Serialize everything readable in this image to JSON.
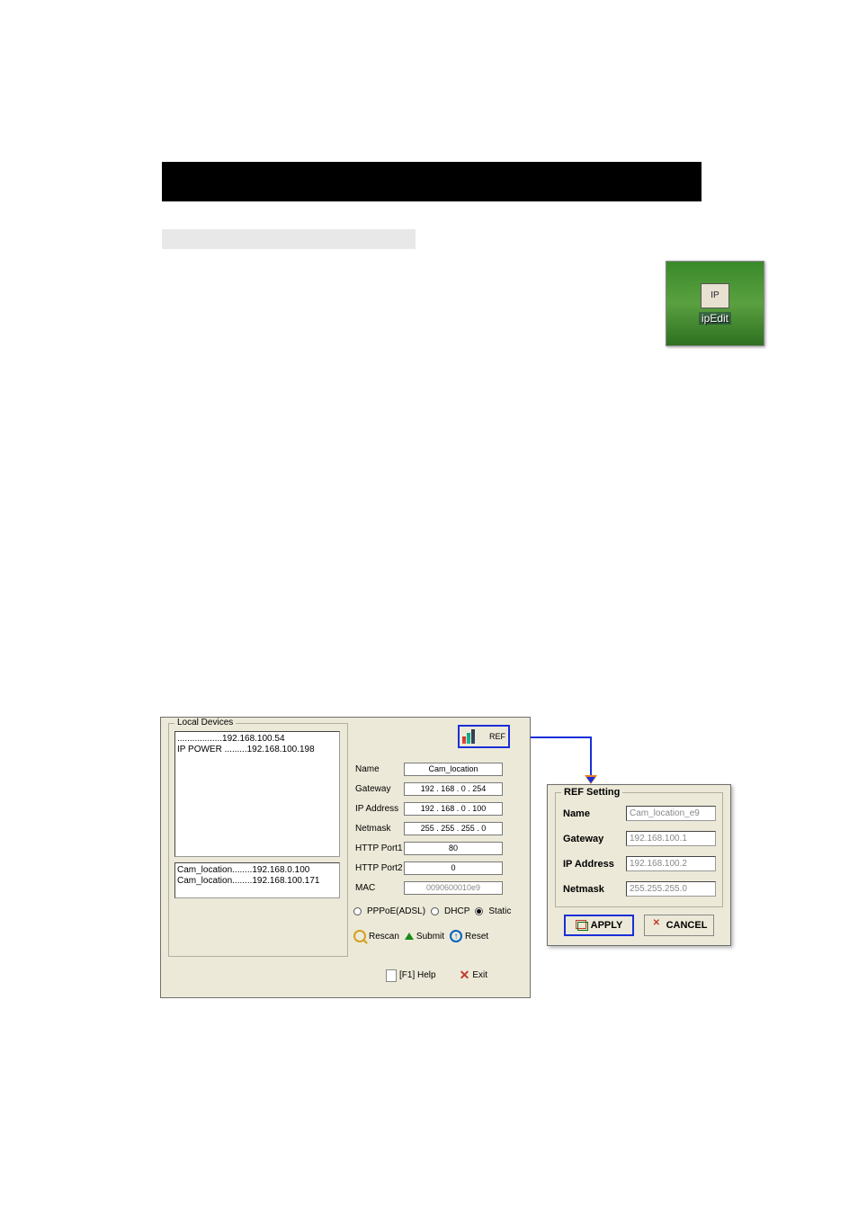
{
  "bars": {
    "black": true,
    "gray": true
  },
  "desktop_icon": {
    "label": "ipEdit",
    "inner": "IP"
  },
  "app": {
    "group_title": "Local Devices",
    "list_top": [
      {
        "text": "..................192.168.100.54",
        "selected": false
      },
      {
        "text": "IP POWER .........192.168.100.198",
        "selected": false
      }
    ],
    "list_bottom": [
      {
        "text": "Cam_location........192.168.0.100",
        "selected": true
      },
      {
        "text": "Cam_location........192.168.100.171",
        "selected": false
      }
    ],
    "ref_button": "REF",
    "fields": {
      "name": {
        "label": "Name",
        "value": "Cam_location"
      },
      "gateway": {
        "label": "Gateway",
        "value": "192 . 168 .   0  . 254"
      },
      "ipaddress": {
        "label": "IP Address",
        "value": "192 . 168 .   0  . 100"
      },
      "netmask": {
        "label": "Netmask",
        "value": "255 . 255 . 255 .   0"
      },
      "http1": {
        "label": "HTTP Port1",
        "value": "80"
      },
      "http2": {
        "label": "HTTP Port2",
        "value": "0"
      },
      "mac": {
        "label": "MAC",
        "value": "0090600010e9"
      }
    },
    "radios": {
      "pppoe": "PPPoE(ADSL)",
      "dhcp": "DHCP",
      "static": "Static",
      "selected": "static"
    },
    "buttons": {
      "rescan": "Rescan",
      "submit": "Submit",
      "reset": "Reset",
      "help": "[F1] Help",
      "exit": "Exit"
    }
  },
  "ref_popup": {
    "title": "REF Setting",
    "rows": {
      "name": {
        "label": "Name",
        "value": "Cam_location_e9"
      },
      "gateway": {
        "label": "Gateway",
        "value": "192.168.100.1"
      },
      "ip": {
        "label": "IP Address",
        "value": "192.168.100.2"
      },
      "netmask": {
        "label": "Netmask",
        "value": "255.255.255.0"
      }
    },
    "apply": "APPLY",
    "cancel": "CANCEL"
  }
}
